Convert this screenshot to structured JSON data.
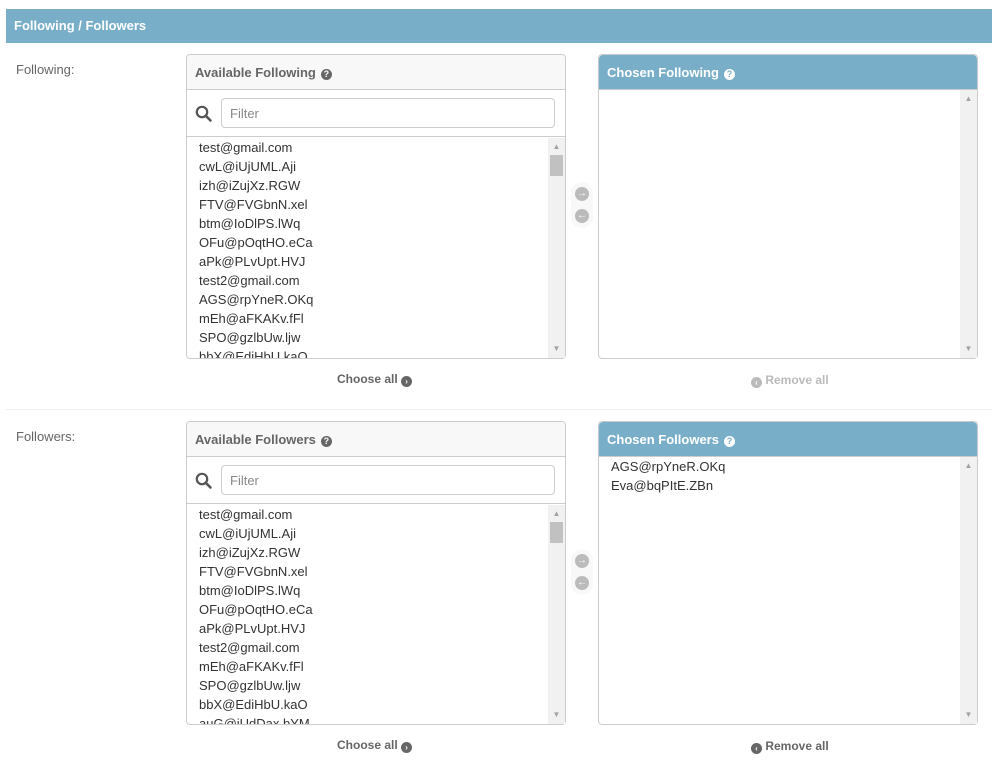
{
  "section": {
    "title": "Following / Followers"
  },
  "following": {
    "label": "Following:",
    "available": {
      "title": "Available Following",
      "filter_placeholder": "Filter",
      "items": [
        "test@gmail.com",
        "cwL@iUjUML.Aji",
        "izh@iZujXz.RGW",
        "FTV@FVGbnN.xel",
        "btm@IoDlPS.lWq",
        "OFu@pOqtHO.eCa",
        "aPk@PLvUpt.HVJ",
        "test2@gmail.com",
        "AGS@rpYneR.OKq",
        "mEh@aFKAKv.fFl",
        "SPO@gzlbUw.ljw",
        "bbX@EdiHbU.kaO"
      ],
      "choose_all": "Choose all"
    },
    "chosen": {
      "title": "Chosen Following",
      "items": [],
      "remove_all": "Remove all"
    }
  },
  "followers": {
    "label": "Followers:",
    "available": {
      "title": "Available Followers",
      "filter_placeholder": "Filter",
      "items": [
        "test@gmail.com",
        "cwL@iUjUML.Aji",
        "izh@iZujXz.RGW",
        "FTV@FVGbnN.xel",
        "btm@IoDlPS.lWq",
        "OFu@pOqtHO.eCa",
        "aPk@PLvUpt.HVJ",
        "test2@gmail.com",
        "mEh@aFKAKv.fFl",
        "SPO@gzlbUw.ljw",
        "bbX@EdiHbU.kaO",
        "auG@iUdDax.bYM"
      ],
      "choose_all": "Choose all"
    },
    "chosen": {
      "title": "Chosen Followers",
      "items": [
        "AGS@rpYneR.OKq",
        "Eva@bqPItE.ZBn"
      ],
      "remove_all": "Remove all"
    }
  },
  "icons": {
    "help": "?",
    "search": "search-icon",
    "add_arrow": "→",
    "remove_arrow": "←",
    "scroll_up": "▲",
    "scroll_down": "▼"
  },
  "colors": {
    "header_bg": "#79aec8",
    "text": "#333333",
    "muted": "#666666",
    "border": "#cccccc",
    "disabled": "#bbbbbb"
  }
}
